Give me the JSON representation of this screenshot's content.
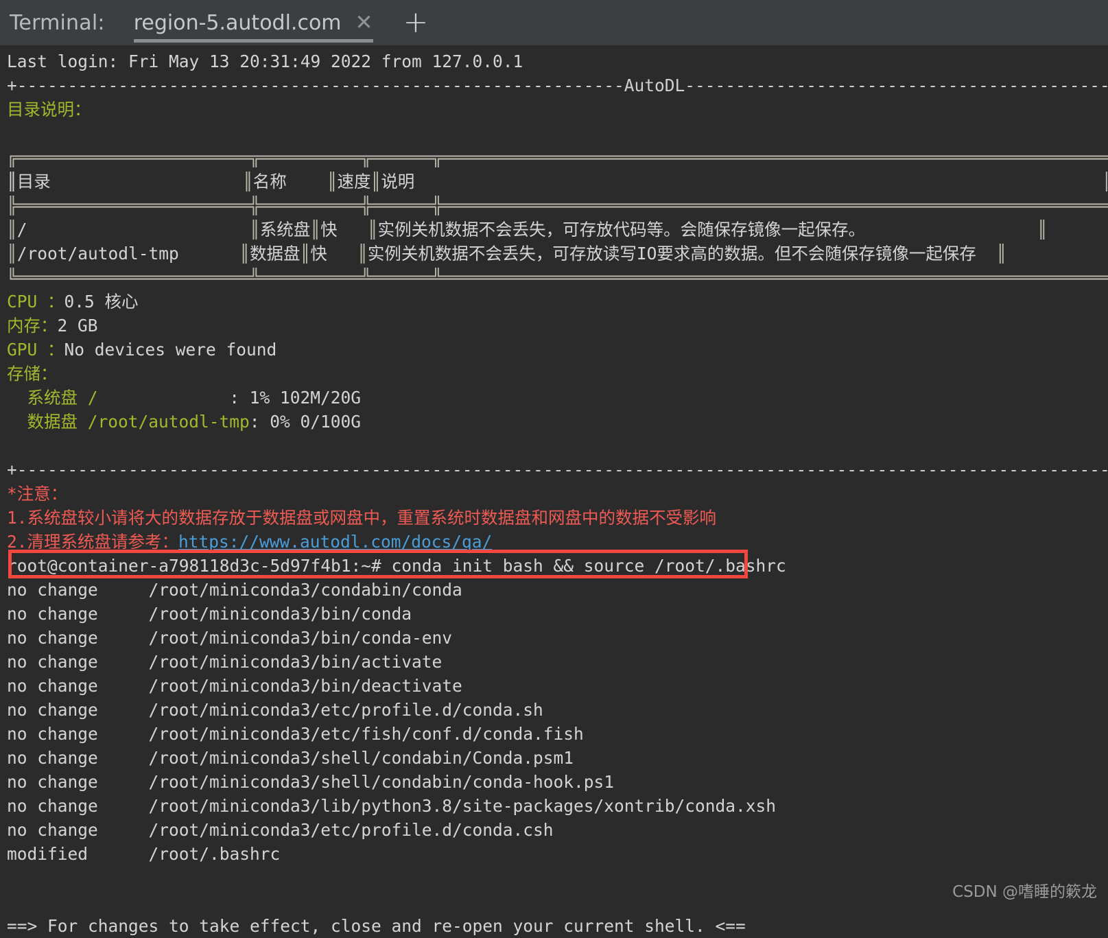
{
  "window": {
    "title_label": "Terminal:",
    "new_tab_icon": "plus-icon",
    "tabs": [
      {
        "label": "region-5.autodl.com",
        "close_icon": "close-icon",
        "active": true
      }
    ]
  },
  "terminal": {
    "last_login": "Last login: Fri May 13 20:31:49 2022 from 127.0.0.1",
    "banner_top": "+------------------------------------------------------------AutoDL------------------------------------------------------------+",
    "banner_bottom": "+--------------------------------------------------------------------------------------------------------------------------------+",
    "dir_heading": "目录说明：",
    "table": {
      "top_border": "╔═══════════════════════╦══════════╦══════╦══════════════════════════════════════════════════════════════════════════════╗",
      "head_sep": "╠═══════════════════════╬══════════╬══════╬══════════════════════════════════════════════════════════════════════════════╣",
      "bottom_border": "╚═══════════════════════╩══════════╩══════╩══════════════════════════════════════════════════════════════════════════════╝",
      "headers": [
        "目录",
        "名称",
        "速度",
        "说明"
      ],
      "rows": [
        {
          "dir": "/",
          "name": "系统盘",
          "speed": "快",
          "desc": "实例关机数据不会丢失，可存放代码等。会随保存镜像一起保存。"
        },
        {
          "dir": "/root/autodl-tmp",
          "name": "数据盘",
          "speed": "快",
          "desc": "实例关机数据不会丢失，可存放读写IO要求高的数据。但不会随保存镜像一起保存"
        }
      ]
    },
    "specs": [
      {
        "label": "CPU ：",
        "value": "0.5 核心"
      },
      {
        "label": "内存：",
        "value": "2 GB"
      },
      {
        "label": "GPU ：",
        "value": "No devices were found"
      },
      {
        "label": "存储：",
        "value": ""
      }
    ],
    "storage": [
      {
        "label": "  系统盘 /",
        "pad": "             ",
        "sep": ": ",
        "value": "1% 102M/20G"
      },
      {
        "label": "  数据盘 /root/autodl-tmp",
        "pad": "",
        "sep": ": ",
        "value": "0% 0/100G"
      }
    ],
    "notice": {
      "title": "*注意：",
      "item1": "1.系统盘较小请将大的数据存放于数据盘或网盘中，重置系统时数据盘和网盘中的数据不受影响",
      "item2_prefix": "2.清理系统盘请参考：",
      "item2_link": "https://www.autodl.com/docs/qa/"
    },
    "prompt": {
      "user_host": "root@container-a798118d3c-5d97f4b1:~# ",
      "command": "conda init bash && source /root/.bashrc",
      "highlight_color": "#f4473f"
    },
    "conda_output": [
      {
        "status": "no change",
        "path": "/root/miniconda3/condabin/conda"
      },
      {
        "status": "no change",
        "path": "/root/miniconda3/bin/conda"
      },
      {
        "status": "no change",
        "path": "/root/miniconda3/bin/conda-env"
      },
      {
        "status": "no change",
        "path": "/root/miniconda3/bin/activate"
      },
      {
        "status": "no change",
        "path": "/root/miniconda3/bin/deactivate"
      },
      {
        "status": "no change",
        "path": "/root/miniconda3/etc/profile.d/conda.sh"
      },
      {
        "status": "no change",
        "path": "/root/miniconda3/etc/fish/conf.d/conda.fish"
      },
      {
        "status": "no change",
        "path": "/root/miniconda3/shell/condabin/Conda.psm1"
      },
      {
        "status": "no change",
        "path": "/root/miniconda3/shell/condabin/conda-hook.ps1"
      },
      {
        "status": "no change",
        "path": "/root/miniconda3/lib/python3.8/site-packages/xontrib/conda.xsh"
      },
      {
        "status": "no change",
        "path": "/root/miniconda3/etc/profile.d/conda.csh"
      },
      {
        "status": "modified",
        "path": "/root/.bashrc"
      }
    ],
    "final_message": "==> For changes to take effect, close and re-open your current shell. <=="
  },
  "watermark": "CSDN @嗜睡的簌龙",
  "colors": {
    "terminal_bg": "#2b2b2b",
    "tabbar_bg": "#3c3f41",
    "green": "#a5b72b",
    "red": "#f05a54",
    "link_blue": "#4a9ed8",
    "text": "#d4d4d4",
    "highlight_box": "#f4473f"
  }
}
